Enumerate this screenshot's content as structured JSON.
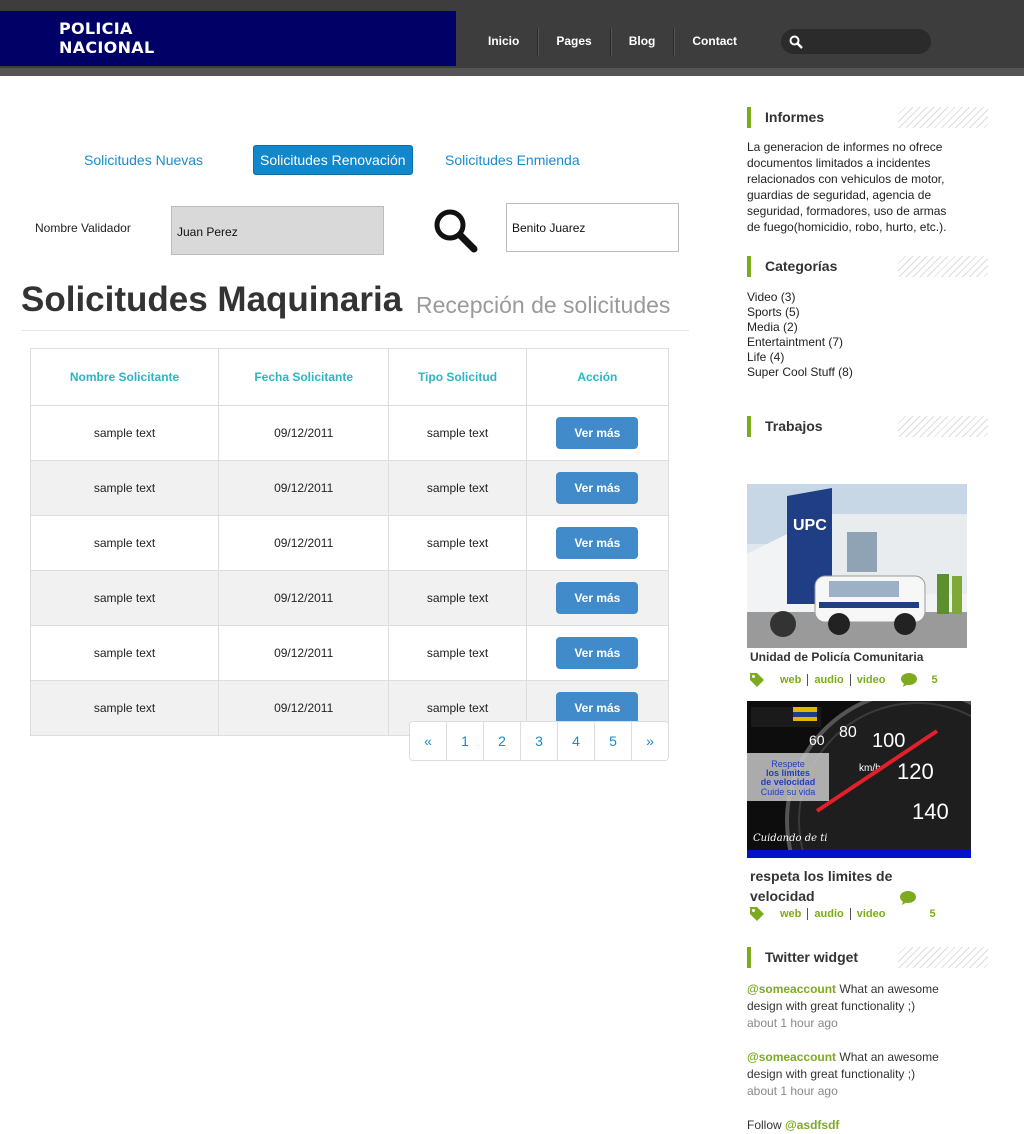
{
  "header": {
    "logo_line1": "POLICIA",
    "logo_line2": "NACIONAL",
    "nav": [
      "Inicio",
      "Pages",
      "Blog",
      "Contact"
    ]
  },
  "tabs": {
    "nuevas": "Solicitudes Nuevas",
    "renovacion": "Solicitudes Renovación",
    "enmienda": "Solicitudes Enmienda"
  },
  "form": {
    "validador_label": "Nombre Validador",
    "validador_value": "Juan Perez",
    "search_value": "Benito Juarez"
  },
  "page": {
    "title": "Solicitudes Maquinaria",
    "subtitle": "Recepción de solicitudes"
  },
  "table": {
    "headers": [
      "Nombre Solicitante",
      "Fecha Solicitante",
      "Tipo Solicitud",
      "Acción"
    ],
    "rows": [
      {
        "nombre": "sample text",
        "fecha": "09/12/2011",
        "tipo": "sample text",
        "accion": "Ver más"
      },
      {
        "nombre": "sample text",
        "fecha": "09/12/2011",
        "tipo": "sample text",
        "accion": "Ver más"
      },
      {
        "nombre": "sample text",
        "fecha": "09/12/2011",
        "tipo": "sample text",
        "accion": "Ver más"
      },
      {
        "nombre": "sample text",
        "fecha": "09/12/2011",
        "tipo": "sample text",
        "accion": "Ver más"
      },
      {
        "nombre": "sample text",
        "fecha": "09/12/2011",
        "tipo": "sample text",
        "accion": "Ver más"
      },
      {
        "nombre": "sample text",
        "fecha": "09/12/2011",
        "tipo": "sample text",
        "accion": "Ver más"
      }
    ]
  },
  "pagination": [
    "«",
    "1",
    "2",
    "3",
    "4",
    "5",
    "»"
  ],
  "sidebar": {
    "informes_title": "Informes",
    "informes_text": "La generacion de informes no ofrece documentos limitados a incidentes relacionados con vehiculos de motor, guardias de seguridad, agencia de seguridad, formadores, uso de armas de fuego(homicidio, robo, hurto, etc.).",
    "categorias_title": "Categorías",
    "categorias": [
      "Video (3)",
      "Sports (5)",
      "Media (2)",
      "Entertaintment (7)",
      "Life (4)",
      "Super Cool Stuff (8)"
    ],
    "trabajos_title": "Trabajos",
    "posts": [
      {
        "title": "Unidad de Policía Comunitaria",
        "tags": [
          "web",
          "audio",
          "video"
        ],
        "comments": "5",
        "image_text": "UPC"
      },
      {
        "title": "respeta los limites de velocidad",
        "tags": [
          "web",
          "audio",
          "video"
        ],
        "comments": "5",
        "image_lines": [
          "Respete",
          "los límites",
          "de velocidad",
          "Cuide su vida"
        ],
        "image_caption": "Cuidando de ti"
      }
    ],
    "twitter_title": "Twitter widget",
    "tweets": [
      {
        "account": "@someaccount",
        "text": " What an awesome design with great functionality ;)",
        "time": "about 1 hour ago"
      },
      {
        "account": "@someaccount",
        "text": " What an awesome design with great functionality ;)",
        "time": "about 1 hour ago"
      }
    ],
    "follow_prefix": "Follow ",
    "follow_account": "@asdfsdf"
  },
  "colors": {
    "accent_green": "#7cab1f",
    "link_blue": "#1a8ccc",
    "header_navy": "#000066",
    "button_blue": "#428bca",
    "table_header_teal": "#2ab7c2"
  }
}
